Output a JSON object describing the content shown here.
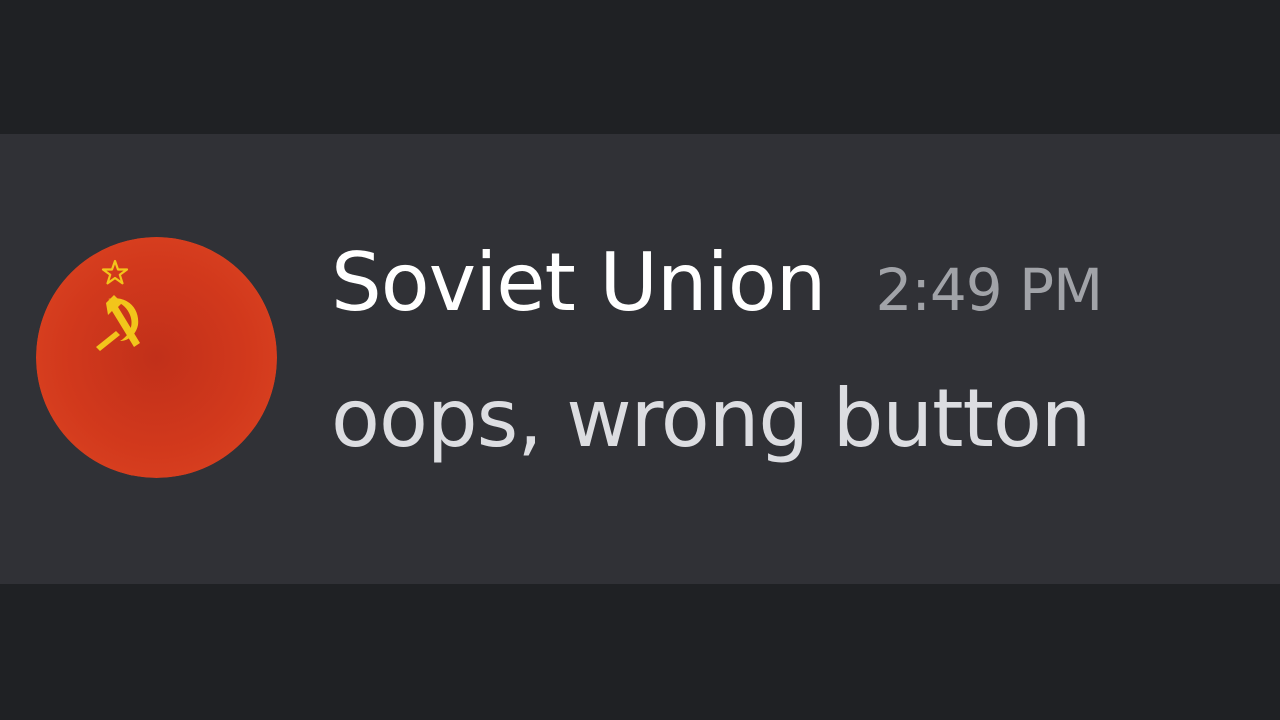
{
  "message": {
    "author": {
      "name": "Soviet Union",
      "avatar_icon": "soviet-flag-avatar-icon"
    },
    "timestamp": "2:49 PM",
    "content": "oops, wrong button"
  },
  "colors": {
    "page_background": "#1f2124",
    "message_background": "#303136",
    "username": "#ffffff",
    "timestamp": "#a1a3a8",
    "content": "#dcdde1",
    "avatar_red": "#d23a1c",
    "emblem_yellow": "#f2c51b"
  }
}
